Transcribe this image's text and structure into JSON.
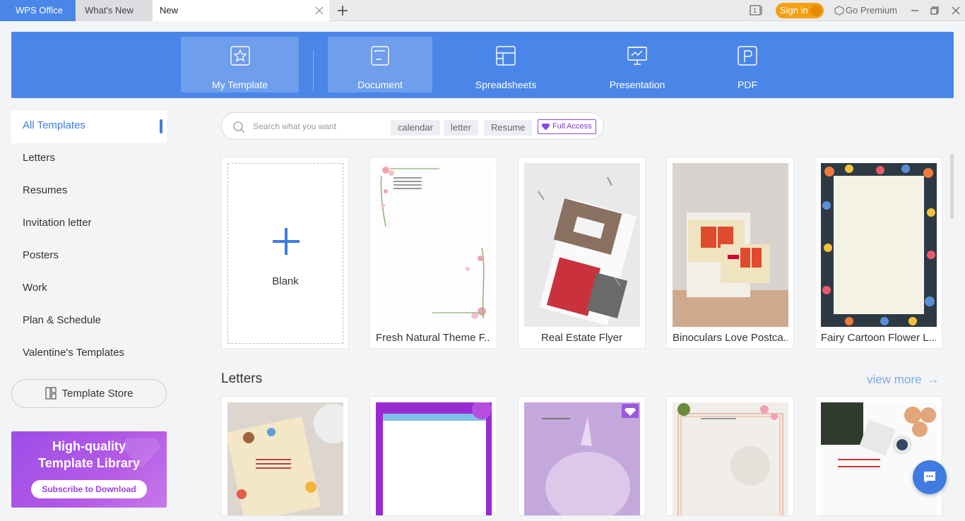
{
  "titlebar": {
    "tabs": [
      {
        "label": "WPS Office"
      },
      {
        "label": "What's New"
      },
      {
        "label": "New"
      }
    ],
    "signin_label": "Sign in",
    "premium_label": "Go Premium",
    "icons": [
      "add-tab-icon",
      "reading-mode-icon",
      "avatar-icon",
      "premium-icon",
      "minimize-icon",
      "restore-icon",
      "close-icon"
    ]
  },
  "categories": [
    {
      "label": "My Template",
      "icon": "star-icon"
    },
    {
      "label": "Document",
      "icon": "document-icon"
    },
    {
      "label": "Spreadsheets",
      "icon": "spreadsheet-icon"
    },
    {
      "label": "Presentation",
      "icon": "presentation-icon"
    },
    {
      "label": "PDF",
      "icon": "pdf-icon"
    }
  ],
  "sidebar": {
    "items": [
      {
        "label": "All Templates"
      },
      {
        "label": "Letters"
      },
      {
        "label": "Resumes"
      },
      {
        "label": "Invitation letter"
      },
      {
        "label": "Posters"
      },
      {
        "label": "Work"
      },
      {
        "label": "Plan & Schedule"
      },
      {
        "label": "Valentine's Templates"
      }
    ],
    "store_label": "Template Store",
    "promo": {
      "line1": "High-quality",
      "line2": "Template Library",
      "button": "Subscribe to Download"
    }
  },
  "search": {
    "placeholder": "Search what you want",
    "chips": [
      "calendar",
      "letter",
      "Resume"
    ],
    "full_access": "Full Access"
  },
  "templates": [
    {
      "label": "Blank"
    },
    {
      "label": "Fresh Natural Theme F..."
    },
    {
      "label": "Real Estate Flyer"
    },
    {
      "label": "Binoculars Love Postca..."
    },
    {
      "label": "Fairy Cartoon Flower L..."
    }
  ],
  "letters": {
    "title": "Letters",
    "view_more": "view more",
    "arrow": "→"
  },
  "colors": {
    "accent": "#4a86e8",
    "premium": "#f4a012",
    "promo": "#b55ae6"
  }
}
